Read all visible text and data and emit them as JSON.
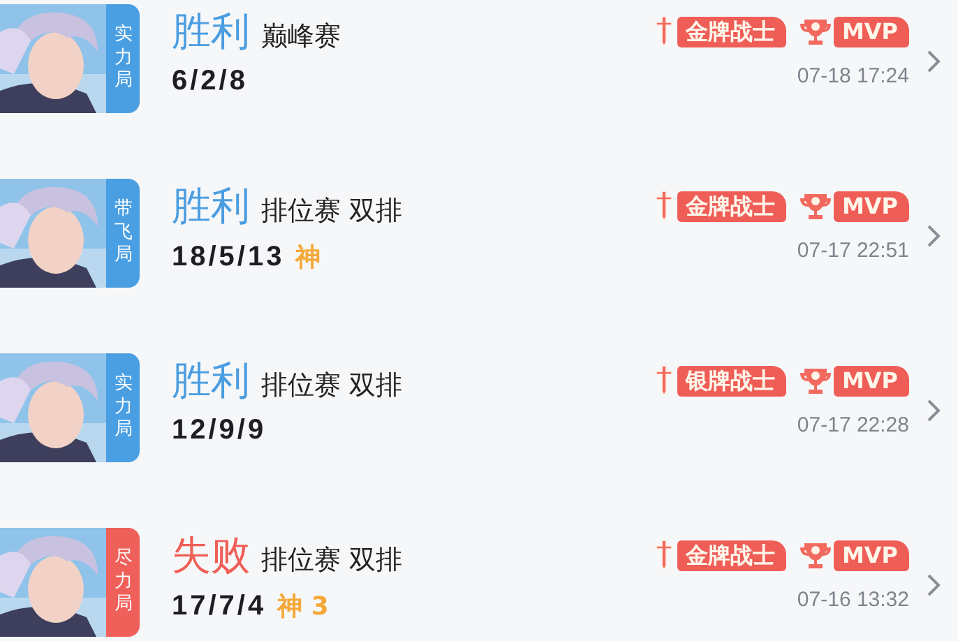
{
  "matches": [
    {
      "tag": "实力局",
      "color": "#4a9fe3",
      "result": "胜利",
      "kind": "win",
      "mode": "巅峰赛",
      "kda": "6/2/8",
      "medal": "金牌战士",
      "mvp": "MVP",
      "time": "07-18 17:24"
    },
    {
      "tag": "带飞局",
      "color": "#4a9fe3",
      "result": "胜利",
      "kind": "win",
      "mode": "排位赛 双排",
      "kda": "18/5/13",
      "honor": "神",
      "medal": "金牌战士",
      "mvp": "MVP",
      "time": "07-17 22:51"
    },
    {
      "tag": "实力局",
      "color": "#4a9fe3",
      "result": "胜利",
      "kind": "win",
      "mode": "排位赛 双排",
      "kda": "12/9/9",
      "medal": "银牌战士",
      "mvp": "MVP",
      "time": "07-17 22:28"
    },
    {
      "tag": "尽力局",
      "color": "#f0605a",
      "result": "失败",
      "kind": "loss",
      "mode": "排位赛 双排",
      "kda": "17/7/4",
      "honor": "神 3",
      "medal": "金牌战士",
      "mvp": "MVP",
      "time": "07-16 13:32"
    }
  ]
}
